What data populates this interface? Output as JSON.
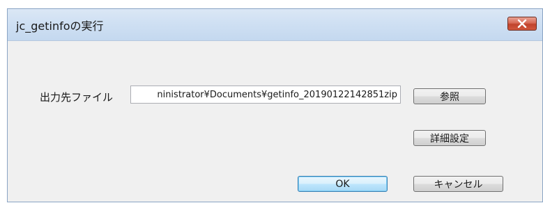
{
  "window": {
    "title": "jc_getinfoの実行",
    "close_icon": "close-icon"
  },
  "form": {
    "output_label": "出力先ファイル",
    "output_path_value": "ninistrator¥Documents¥getinfo_20190122142851zip"
  },
  "buttons": {
    "browse_label": "参照",
    "advanced_label": "詳細設定",
    "ok_label": "OK",
    "cancel_label": "キャンセル"
  },
  "colors": {
    "close_button": "#c0432c",
    "titlebar": "#cfe0f3",
    "ok_border": "#3c7fb1"
  }
}
